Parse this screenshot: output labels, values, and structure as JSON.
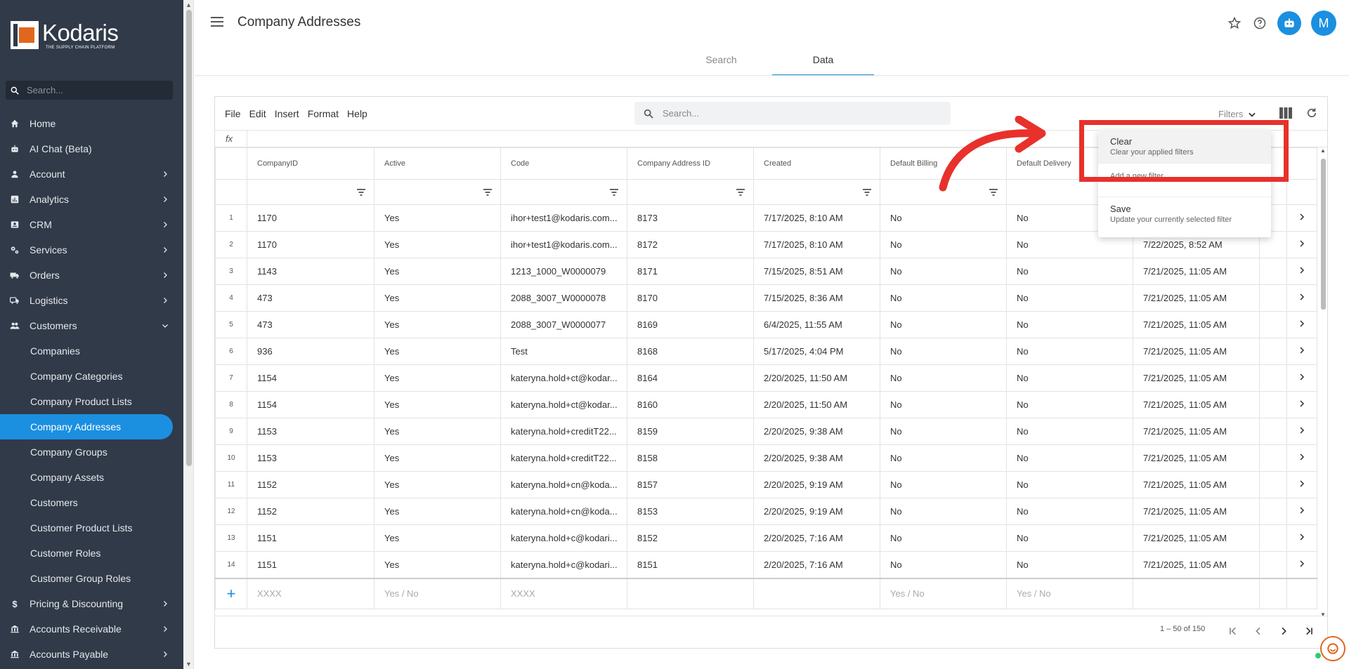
{
  "sidebar": {
    "brand": "Kodaris",
    "tagline": "THE SUPPLY CHAIN PLATFORM",
    "search_placeholder": "Search...",
    "items": [
      {
        "label": "Home",
        "icon": "home-icon",
        "chevron": false
      },
      {
        "label": "AI Chat (Beta)",
        "icon": "robot-icon",
        "chevron": false
      },
      {
        "label": "Account",
        "icon": "person-icon",
        "chevron": true
      },
      {
        "label": "Analytics",
        "icon": "chart-icon",
        "chevron": true
      },
      {
        "label": "CRM",
        "icon": "contact-card-icon",
        "chevron": true
      },
      {
        "label": "Services",
        "icon": "gears-icon",
        "chevron": true
      },
      {
        "label": "Orders",
        "icon": "truck-icon",
        "chevron": true
      },
      {
        "label": "Logistics",
        "icon": "delivery-truck-icon",
        "chevron": true
      },
      {
        "label": "Customers",
        "icon": "people-icon",
        "chevron": true,
        "expanded": true
      }
    ],
    "sub_items": [
      "Companies",
      "Company Categories",
      "Company Product Lists",
      "Company Addresses",
      "Company Groups",
      "Company Assets",
      "Customers",
      "Customer Product Lists",
      "Customer Roles",
      "Customer Group Roles"
    ],
    "active_sub": "Company Addresses",
    "bottom_items": [
      {
        "label": "Pricing & Discounting",
        "icon": "dollar-icon"
      },
      {
        "label": "Accounts Receivable",
        "icon": "bank-icon"
      },
      {
        "label": "Accounts Payable",
        "icon": "bank-icon"
      }
    ]
  },
  "header": {
    "title": "Company Addresses",
    "avatar_initial": "M"
  },
  "tabs": [
    {
      "label": "Search",
      "active": false
    },
    {
      "label": "Data",
      "active": true
    }
  ],
  "grid": {
    "menu": [
      "File",
      "Edit",
      "Insert",
      "Format",
      "Help"
    ],
    "search_placeholder": "Search...",
    "filters_label": "Filters",
    "fx_label": "fx",
    "columns": [
      "CompanyID",
      "Active",
      "Code",
      "Company Address ID",
      "Created",
      "Default Billing",
      "Default Delivery",
      "",
      ""
    ],
    "rows": [
      [
        "1",
        "1170",
        "Yes",
        "ihor+test1@kodaris.com...",
        "8173",
        "7/17/2025, 8:10 AM",
        "No",
        "No",
        ""
      ],
      [
        "2",
        "1170",
        "Yes",
        "ihor+test1@kodaris.com...",
        "8172",
        "7/17/2025, 8:10 AM",
        "No",
        "No",
        "7/22/2025, 8:52 AM"
      ],
      [
        "3",
        "1143",
        "Yes",
        "1213_1000_W0000079",
        "8171",
        "7/15/2025, 8:51 AM",
        "No",
        "No",
        "7/21/2025, 11:05 AM"
      ],
      [
        "4",
        "473",
        "Yes",
        "2088_3007_W0000078",
        "8170",
        "7/15/2025, 8:36 AM",
        "No",
        "No",
        "7/21/2025, 11:05 AM"
      ],
      [
        "5",
        "473",
        "Yes",
        "2088_3007_W0000077",
        "8169",
        "6/4/2025, 11:55 AM",
        "No",
        "No",
        "7/21/2025, 11:05 AM"
      ],
      [
        "6",
        "936",
        "Yes",
        "Test",
        "8168",
        "5/17/2025, 4:04 PM",
        "No",
        "No",
        "7/21/2025, 11:05 AM"
      ],
      [
        "7",
        "1154",
        "Yes",
        "kateryna.hold+ct@kodar...",
        "8164",
        "2/20/2025, 11:50 AM",
        "No",
        "No",
        "7/21/2025, 11:05 AM"
      ],
      [
        "8",
        "1154",
        "Yes",
        "kateryna.hold+ct@kodar...",
        "8160",
        "2/20/2025, 11:50 AM",
        "No",
        "No",
        "7/21/2025, 11:05 AM"
      ],
      [
        "9",
        "1153",
        "Yes",
        "kateryna.hold+creditT22...",
        "8159",
        "2/20/2025, 9:38 AM",
        "No",
        "No",
        "7/21/2025, 11:05 AM"
      ],
      [
        "10",
        "1153",
        "Yes",
        "kateryna.hold+creditT22...",
        "8158",
        "2/20/2025, 9:38 AM",
        "No",
        "No",
        "7/21/2025, 11:05 AM"
      ],
      [
        "11",
        "1152",
        "Yes",
        "kateryna.hold+cn@koda...",
        "8157",
        "2/20/2025, 9:19 AM",
        "No",
        "No",
        "7/21/2025, 11:05 AM"
      ],
      [
        "12",
        "1152",
        "Yes",
        "kateryna.hold+cn@koda...",
        "8153",
        "2/20/2025, 9:19 AM",
        "No",
        "No",
        "7/21/2025, 11:05 AM"
      ],
      [
        "13",
        "1151",
        "Yes",
        "kateryna.hold+c@kodari...",
        "8152",
        "2/20/2025, 7:16 AM",
        "No",
        "No",
        "7/21/2025, 11:05 AM"
      ],
      [
        "14",
        "1151",
        "Yes",
        "kateryna.hold+c@kodari...",
        "8151",
        "2/20/2025, 7:16 AM",
        "No",
        "No",
        "7/21/2025, 11:05 AM"
      ]
    ],
    "new_row": [
      "XXXX",
      "Yes / No",
      "XXXX",
      "",
      "",
      "Yes / No",
      "Yes / No",
      ""
    ],
    "pagination": "1 – 50 of 150"
  },
  "filters_menu": [
    {
      "title": "Clear",
      "subtitle": "Clear your applied filters"
    },
    {
      "title": "",
      "subtitle": "Add a new filter"
    },
    {
      "title": "Save",
      "subtitle": "Update your currently selected filter"
    }
  ],
  "colors": {
    "sidebar_bg": "#303a49",
    "accent": "#1b8fe0",
    "highlight": "#e8312b",
    "brand_orange": "#e1671e"
  }
}
